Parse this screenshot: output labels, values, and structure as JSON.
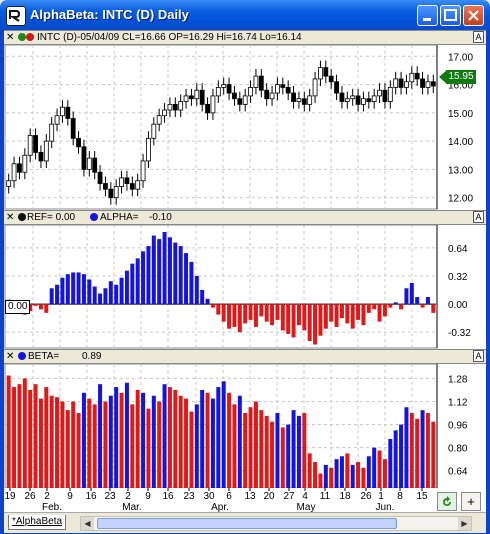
{
  "window": {
    "title": "AlphaBeta: INTC (D) Daily"
  },
  "colors": {
    "price": "#000000",
    "alpha_pos": "#1414dc",
    "alpha_neg": "#e01818",
    "beta_up": "#1414dc",
    "beta_down": "#e01818",
    "grid": "#c8c8c8"
  },
  "price_pane": {
    "close_icon": "close-x-icon",
    "legend": "INTC (D)-05/04/09 CL=16.66 OP=16.29 Hi=16.74 Lo=16.14",
    "last_price": "15.95",
    "axis_button": "A"
  },
  "alpha_pane": {
    "ref_label": "REF= 0.00",
    "alpha_label": "ALPHA=",
    "alpha_value": "-0.10",
    "zero_marker": "0.00",
    "axis_button": "A"
  },
  "beta_pane": {
    "beta_label": "BETA=",
    "beta_value": "0.89",
    "axis_button": "A"
  },
  "x_axis": {
    "day_labels": [
      "19",
      "26",
      "2",
      "9",
      "16",
      "23",
      "2",
      "9",
      "16",
      "23",
      "30",
      "6",
      "13",
      "20",
      "27",
      "4",
      "11",
      "18",
      "26",
      "1",
      "8",
      "15"
    ],
    "month_labels": [
      "Feb.",
      "Mar.",
      "Apr.",
      "May",
      "Jun."
    ]
  },
  "bottom": {
    "sheet_tab": "*AlphaBeta",
    "refresh_icon": "refresh-icon",
    "add_icon": "plus-icon",
    "add_label": "+"
  },
  "chart_data": [
    {
      "type": "candlestick",
      "title": "INTC (D) Daily",
      "ylim": [
        11.6,
        17.4
      ],
      "yticks": [
        12.0,
        13.0,
        14.0,
        15.0,
        16.0,
        17.0
      ],
      "close": [
        12.6,
        13.2,
        12.9,
        13.5,
        14.2,
        13.6,
        13.3,
        14.0,
        14.6,
        14.9,
        15.2,
        14.8,
        14.1,
        13.8,
        13.0,
        13.4,
        12.9,
        12.5,
        12.3,
        12.0,
        12.4,
        12.7,
        12.5,
        12.3,
        12.6,
        13.3,
        14.1,
        14.6,
        14.9,
        15.1,
        15.3,
        15.1,
        15.4,
        15.6,
        15.5,
        15.8,
        15.3,
        15.0,
        15.6,
        15.9,
        16.0,
        15.7,
        15.5,
        15.3,
        15.6,
        15.9,
        16.3,
        15.8,
        15.5,
        15.7,
        16.0,
        15.9,
        15.7,
        15.4,
        15.5,
        15.3,
        15.6,
        16.2,
        16.6,
        16.3,
        16.1,
        15.7,
        15.4,
        15.5,
        15.6,
        15.3,
        15.5,
        15.4,
        15.6,
        15.8,
        15.4,
        15.9,
        16.2,
        15.9,
        16.1,
        16.4,
        16.2,
        15.9,
        16.1,
        15.95
      ],
      "volatility_note": ""
    },
    {
      "type": "bar",
      "title": "ALPHA",
      "ylim": [
        -0.5,
        0.9
      ],
      "yticks": [
        -0.32,
        0.0,
        0.32,
        0.64
      ],
      "values": [
        0.05,
        0.02,
        -0.05,
        -0.12,
        -0.08,
        -0.02,
        -0.06,
        -0.1,
        0.18,
        0.22,
        0.3,
        0.34,
        0.36,
        0.36,
        0.34,
        0.28,
        0.2,
        0.12,
        0.18,
        0.26,
        0.22,
        0.3,
        0.38,
        0.46,
        0.52,
        0.6,
        0.66,
        0.78,
        0.74,
        0.82,
        0.76,
        0.7,
        0.66,
        0.58,
        0.48,
        0.32,
        0.16,
        0.06,
        -0.04,
        -0.12,
        -0.2,
        -0.28,
        -0.26,
        -0.32,
        -0.22,
        -0.18,
        -0.26,
        -0.14,
        -0.2,
        -0.24,
        -0.18,
        -0.3,
        -0.34,
        -0.38,
        -0.24,
        -0.3,
        -0.42,
        -0.46,
        -0.36,
        -0.28,
        -0.2,
        -0.26,
        -0.16,
        -0.22,
        -0.28,
        -0.18,
        -0.24,
        -0.1,
        -0.06,
        -0.2,
        -0.14,
        -0.04,
        0.02,
        -0.06,
        0.18,
        0.24,
        0.08,
        -0.04,
        0.08,
        -0.1
      ]
    },
    {
      "type": "bar",
      "title": "BETA",
      "ylim": [
        0.52,
        1.38
      ],
      "yticks": [
        0.64,
        0.8,
        0.96,
        1.12,
        1.28
      ],
      "values": [
        1.3,
        1.22,
        1.24,
        1.28,
        1.2,
        1.24,
        1.14,
        1.22,
        1.16,
        1.15,
        1.12,
        1.06,
        1.12,
        1.04,
        1.18,
        1.14,
        1.1,
        1.24,
        1.12,
        1.16,
        1.22,
        1.18,
        1.25,
        1.1,
        1.2,
        1.18,
        1.07,
        1.16,
        1.12,
        1.24,
        1.22,
        1.2,
        1.16,
        1.14,
        1.05,
        1.1,
        1.2,
        1.18,
        1.14,
        1.22,
        1.26,
        1.18,
        1.1,
        1.16,
        1.04,
        1.08,
        1.12,
        1.06,
        1.02,
        0.98,
        1.04,
        0.94,
        0.96,
        1.06,
        1.02,
        1.04,
        0.76,
        0.7,
        0.62,
        0.68,
        0.66,
        0.72,
        0.74,
        0.76,
        0.68,
        0.7,
        0.66,
        0.74,
        0.8,
        0.78,
        0.72,
        0.86,
        0.92,
        0.96,
        1.08,
        1.04,
        1.0,
        1.06,
        1.04,
        0.98
      ],
      "up": [
        0,
        0,
        0,
        0,
        0,
        0,
        0,
        0,
        0,
        0,
        0,
        0,
        0,
        0,
        1,
        0,
        0,
        1,
        0,
        1,
        1,
        0,
        1,
        0,
        0,
        1,
        0,
        1,
        0,
        1,
        0,
        0,
        0,
        0,
        0,
        1,
        1,
        0,
        1,
        1,
        1,
        0,
        0,
        1,
        0,
        0,
        0,
        0,
        0,
        0,
        1,
        0,
        1,
        1,
        1,
        0,
        0,
        0,
        0,
        1,
        0,
        1,
        1,
        0,
        1,
        0,
        0,
        1,
        1,
        0,
        0,
        1,
        1,
        1,
        1,
        0,
        0,
        1,
        0,
        0
      ]
    }
  ]
}
